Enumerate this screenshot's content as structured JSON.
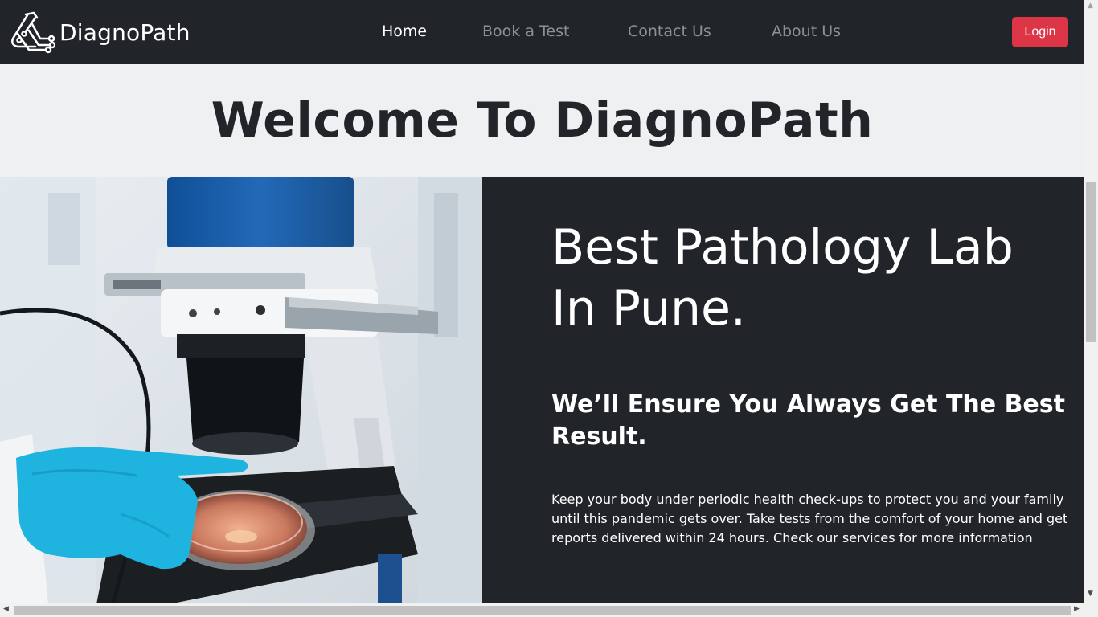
{
  "nav": {
    "brand": "DiagnoPath",
    "links": [
      {
        "label": "Home",
        "active": true
      },
      {
        "label": "Book a Test",
        "active": false
      },
      {
        "label": "Contact Us",
        "active": false
      },
      {
        "label": "About Us",
        "active": false
      }
    ],
    "login_label": "Login"
  },
  "welcome": {
    "heading": "Welcome To DiagnoPath"
  },
  "hero": {
    "title_line1": "Best Pathology Lab",
    "title_line2": "In Pune.",
    "subtitle": "We’ll Ensure You Always Get The Best Result.",
    "description": "Keep your body under periodic health check-ups to protect you and your family until this pandemic gets over. Take tests from the comfort of your home and get reports delivered within 24 hours. Check our services for more information"
  },
  "icons": {
    "logo": "lab-flask-circuit-icon",
    "hero_image": "microscope-lab-photo"
  },
  "colors": {
    "navbar_bg": "#212529",
    "welcome_bg": "#eef0f1",
    "login_bg": "#dc3545",
    "nav_inactive": "#8d9196",
    "glove": "#1fb3e0"
  }
}
